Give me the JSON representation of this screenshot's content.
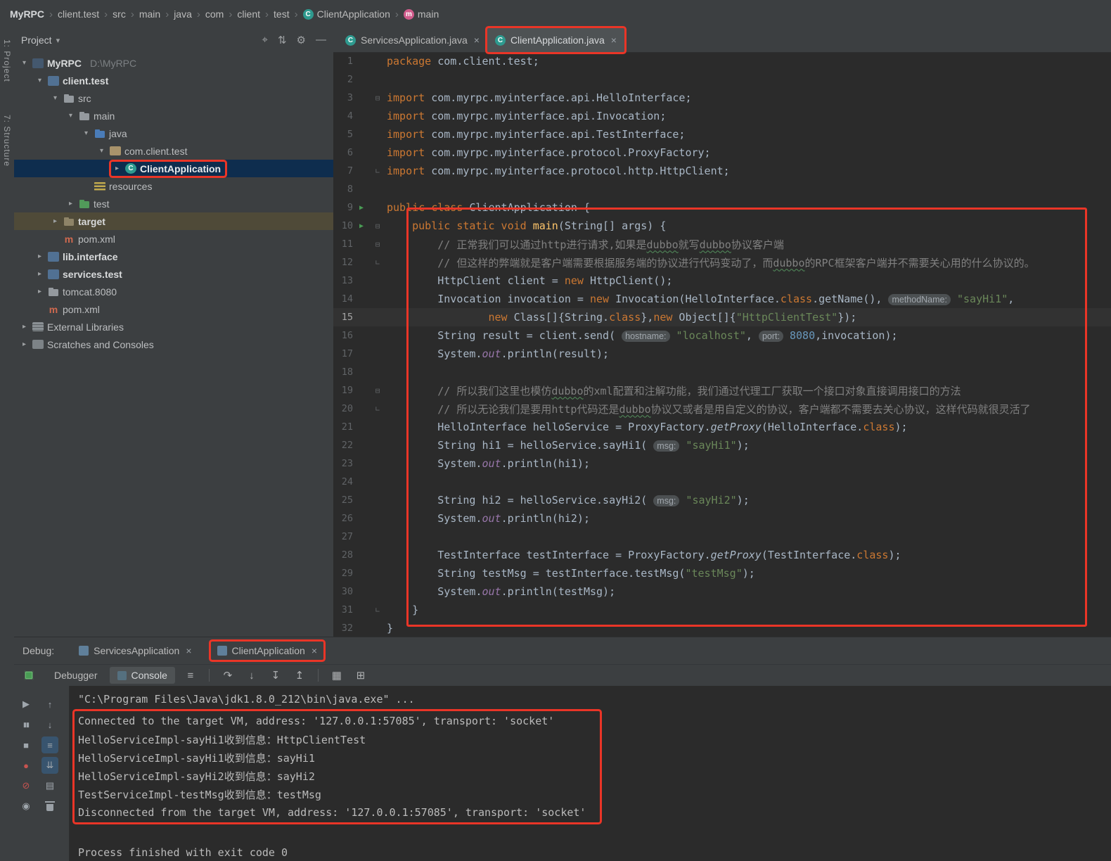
{
  "colors": {
    "annotation_red": "#ea3527",
    "keyword_orange": "#cc7832",
    "string_green": "#6a8759",
    "number_blue": "#6897bb",
    "comment_gray": "#808080",
    "selection_navy": "#0e2d4e"
  },
  "navbar": {
    "items": [
      {
        "label": "MyRPC"
      },
      {
        "label": "client.test"
      },
      {
        "label": "src"
      },
      {
        "label": "main"
      },
      {
        "label": "java"
      },
      {
        "label": "com"
      },
      {
        "label": "client"
      },
      {
        "label": "test"
      },
      {
        "label": "ClientApplication",
        "icon": "class"
      },
      {
        "label": "main",
        "icon": "method"
      }
    ]
  },
  "tool_stripe": {
    "top": "1: Project",
    "middle": "7: Structure"
  },
  "project": {
    "header": {
      "title": "Project"
    },
    "tree": [
      {
        "label": "MyRPC",
        "suffix": "D:\\MyRPC",
        "indent": 0,
        "chevron": "open",
        "icon": "project",
        "bold": true
      },
      {
        "label": "client.test",
        "indent": 1,
        "chevron": "open",
        "icon": "module",
        "bold": true
      },
      {
        "label": "src",
        "indent": 2,
        "chevron": "open",
        "icon": "folder"
      },
      {
        "label": "main",
        "indent": 3,
        "chevron": "open",
        "icon": "folder"
      },
      {
        "label": "java",
        "indent": 4,
        "chevron": "open",
        "icon": "folder-source"
      },
      {
        "label": "com.client.test",
        "indent": 5,
        "chevron": "open",
        "icon": "package"
      },
      {
        "label": "ClientApplication",
        "indent": 6,
        "chevron": "closed",
        "icon": "class",
        "selected": true,
        "boxed": true
      },
      {
        "label": "resources",
        "indent": 4,
        "chevron": "",
        "icon": "folder-resources"
      },
      {
        "label": "test",
        "indent": 3,
        "chevron": "closed",
        "icon": "folder-test"
      },
      {
        "label": "target",
        "indent": 2,
        "chevron": "closed",
        "icon": "folder-excluded",
        "highlight": "target",
        "bold": true
      },
      {
        "label": "pom.xml",
        "indent": 2,
        "chevron": "",
        "icon": "maven"
      },
      {
        "label": "lib.interface",
        "indent": 1,
        "chevron": "closed",
        "icon": "module",
        "bold": true
      },
      {
        "label": "services.test",
        "indent": 1,
        "chevron": "closed",
        "icon": "module",
        "bold": true
      },
      {
        "label": "tomcat.8080",
        "indent": 1,
        "chevron": "closed",
        "icon": "folder"
      },
      {
        "label": "pom.xml",
        "indent": 1,
        "chevron": "",
        "icon": "maven"
      },
      {
        "label": "External Libraries",
        "indent": 0,
        "chevron": "closed",
        "icon": "libraries"
      },
      {
        "label": "Scratches and Consoles",
        "indent": 0,
        "chevron": "closed",
        "icon": "scratches"
      }
    ]
  },
  "editor": {
    "tabs": [
      {
        "label": "ServicesApplication.java",
        "icon": "class",
        "close": "×",
        "active": false,
        "boxed": false
      },
      {
        "label": "ClientApplication.java",
        "icon": "class",
        "close": "×",
        "active": true,
        "boxed": true
      }
    ],
    "code": [
      {
        "n": 1,
        "g": "",
        "t": [
          [
            "k",
            "package"
          ],
          [
            "d",
            " com.client.test;"
          ]
        ]
      },
      {
        "n": 2,
        "g": "",
        "t": []
      },
      {
        "n": 3,
        "g": "fold",
        "t": [
          [
            "k",
            "import"
          ],
          [
            "d",
            " com.myrpc.myinterface.api.HelloInterface;"
          ]
        ]
      },
      {
        "n": 4,
        "g": "",
        "t": [
          [
            "k",
            "import"
          ],
          [
            "d",
            " com.myrpc.myinterface.api.Invocation;"
          ]
        ]
      },
      {
        "n": 5,
        "g": "",
        "t": [
          [
            "k",
            "import"
          ],
          [
            "d",
            " com.myrpc.myinterface.api.TestInterface;"
          ]
        ]
      },
      {
        "n": 6,
        "g": "",
        "t": [
          [
            "k",
            "import"
          ],
          [
            "d",
            " com.myrpc.myinterface.protocol.ProxyFactory;"
          ]
        ]
      },
      {
        "n": 7,
        "g": "foldend",
        "t": [
          [
            "k",
            "import"
          ],
          [
            "d",
            " com.myrpc.myinterface.protocol.http.HttpClient;"
          ]
        ]
      },
      {
        "n": 8,
        "g": "",
        "t": []
      },
      {
        "n": 9,
        "g": "play",
        "t": [
          [
            "k",
            "public class "
          ],
          [
            "d",
            "ClientApplication {"
          ]
        ]
      },
      {
        "n": 10,
        "g": "play fold",
        "t": [
          [
            "d",
            "    "
          ],
          [
            "k",
            "public static void "
          ],
          [
            "m",
            "main"
          ],
          [
            "d",
            "(String[] args) {"
          ]
        ]
      },
      {
        "n": 11,
        "g": "fold",
        "t": [
          [
            "c",
            "        // 正常我们可以通过http进行请求,如果是"
          ],
          [
            "cu",
            "dubbo"
          ],
          [
            "c",
            "就写"
          ],
          [
            "cu",
            "dubbo"
          ],
          [
            "c",
            "协议客户端"
          ]
        ]
      },
      {
        "n": 12,
        "g": "foldend",
        "t": [
          [
            "c",
            "        // 但这样的弊端就是客户端需要根据服务端的协议进行代码变动了，而"
          ],
          [
            "cu",
            "dubbo"
          ],
          [
            "c",
            "的RPC框架客户端并不需要关心用的什么协议的。"
          ]
        ]
      },
      {
        "n": 13,
        "g": "",
        "t": [
          [
            "d",
            "        HttpClient client = "
          ],
          [
            "k",
            "new"
          ],
          [
            "d",
            " HttpClient();"
          ]
        ]
      },
      {
        "n": 14,
        "g": "",
        "t": [
          [
            "d",
            "        Invocation invocation = "
          ],
          [
            "k",
            "new"
          ],
          [
            "d",
            " Invocation(HelloInterface."
          ],
          [
            "k",
            "class"
          ],
          [
            "d",
            ".getName(), "
          ],
          [
            "h",
            "methodName:"
          ],
          [
            "d",
            " "
          ],
          [
            "s",
            "\"sayHi1\""
          ],
          [
            "d",
            ","
          ]
        ]
      },
      {
        "n": 15,
        "g": "",
        "caret": true,
        "t": [
          [
            "d",
            "                "
          ],
          [
            "k",
            "new"
          ],
          [
            "d",
            " Class[]{String."
          ],
          [
            "k",
            "class"
          ],
          [
            "d",
            "},"
          ],
          [
            "k",
            "new"
          ],
          [
            "d",
            " Object[]{"
          ],
          [
            "s",
            "\"HttpClientTest\""
          ],
          [
            "d",
            "});"
          ]
        ]
      },
      {
        "n": 16,
        "g": "",
        "t": [
          [
            "d",
            "        String result = client.send( "
          ],
          [
            "h",
            "hostname:"
          ],
          [
            "d",
            " "
          ],
          [
            "s",
            "\"localhost\""
          ],
          [
            "d",
            ", "
          ],
          [
            "h",
            "port:"
          ],
          [
            "d",
            " "
          ],
          [
            "n",
            "8080"
          ],
          [
            "d",
            ",invocation);"
          ]
        ]
      },
      {
        "n": 17,
        "g": "",
        "t": [
          [
            "d",
            "        System."
          ],
          [
            "f",
            "out"
          ],
          [
            "d",
            ".println(result);"
          ]
        ]
      },
      {
        "n": 18,
        "g": "",
        "t": []
      },
      {
        "n": 19,
        "g": "fold",
        "t": [
          [
            "c",
            "        // 所以我们这里也模仿"
          ],
          [
            "cu",
            "dubbo"
          ],
          [
            "c",
            "的xml配置和注解功能，我们通过代理工厂获取一个接口对象直接调用接口的方法"
          ]
        ]
      },
      {
        "n": 20,
        "g": "foldend",
        "t": [
          [
            "c",
            "        // 所以无论我们是要用http代码还是"
          ],
          [
            "cu",
            "dubbo"
          ],
          [
            "c",
            "协议又或者是用自定义的协议，客户端都不需要去关心协议，这样代码就很灵活了"
          ]
        ]
      },
      {
        "n": 21,
        "g": "",
        "t": [
          [
            "d",
            "        HelloInterface helloService = ProxyFactory."
          ],
          [
            "sm",
            "getProxy"
          ],
          [
            "d",
            "(HelloInterface."
          ],
          [
            "k",
            "class"
          ],
          [
            "d",
            ");"
          ]
        ]
      },
      {
        "n": 22,
        "g": "",
        "t": [
          [
            "d",
            "        String hi1 = helloService.sayHi1( "
          ],
          [
            "h",
            "msg:"
          ],
          [
            "d",
            " "
          ],
          [
            "s",
            "\"sayHi1\""
          ],
          [
            "d",
            ");"
          ]
        ]
      },
      {
        "n": 23,
        "g": "",
        "t": [
          [
            "d",
            "        System."
          ],
          [
            "f",
            "out"
          ],
          [
            "d",
            ".println(hi1);"
          ]
        ]
      },
      {
        "n": 24,
        "g": "",
        "t": []
      },
      {
        "n": 25,
        "g": "",
        "t": [
          [
            "d",
            "        String hi2 = helloService.sayHi2( "
          ],
          [
            "h",
            "msg:"
          ],
          [
            "d",
            " "
          ],
          [
            "s",
            "\"sayHi2\""
          ],
          [
            "d",
            ");"
          ]
        ]
      },
      {
        "n": 26,
        "g": "",
        "t": [
          [
            "d",
            "        System."
          ],
          [
            "f",
            "out"
          ],
          [
            "d",
            ".println(hi2);"
          ]
        ]
      },
      {
        "n": 27,
        "g": "",
        "t": []
      },
      {
        "n": 28,
        "g": "",
        "t": [
          [
            "d",
            "        TestInterface testInterface = ProxyFactory."
          ],
          [
            "sm",
            "getProxy"
          ],
          [
            "d",
            "(TestInterface."
          ],
          [
            "k",
            "class"
          ],
          [
            "d",
            ");"
          ]
        ]
      },
      {
        "n": 29,
        "g": "",
        "t": [
          [
            "d",
            "        String testMsg = testInterface.testMsg("
          ],
          [
            "s",
            "\"testMsg\""
          ],
          [
            "d",
            ");"
          ]
        ]
      },
      {
        "n": 30,
        "g": "",
        "t": [
          [
            "d",
            "        System."
          ],
          [
            "f",
            "out"
          ],
          [
            "d",
            ".println(testMsg);"
          ]
        ]
      },
      {
        "n": 31,
        "g": "foldend",
        "t": [
          [
            "d",
            "    }"
          ]
        ]
      },
      {
        "n": 32,
        "g": "",
        "t": [
          [
            "d",
            "}"
          ]
        ]
      }
    ]
  },
  "debug": {
    "label": "Debug:",
    "session_tabs": [
      {
        "label": "ServicesApplication",
        "close": "×",
        "boxed": false
      },
      {
        "label": "ClientApplication",
        "close": "×",
        "boxed": true
      }
    ],
    "view_tabs": [
      {
        "label": "Debugger",
        "active": false,
        "icon": ""
      },
      {
        "label": "Console",
        "active": true,
        "icon": "console"
      }
    ],
    "console": {
      "lines": [
        {
          "text": "\"C:\\Program Files\\Java\\jdk1.8.0_212\\bin\\java.exe\" ...",
          "boxed": false
        },
        {
          "text": "Connected to the target VM, address: '127.0.0.1:57085', transport: 'socket'",
          "boxed": true
        },
        {
          "text": "HelloServiceImpl-sayHi1收到信息：HttpClientTest",
          "boxed": true
        },
        {
          "text": "HelloServiceImpl-sayHi1收到信息：sayHi1",
          "boxed": true
        },
        {
          "text": "HelloServiceImpl-sayHi2收到信息：sayHi2",
          "boxed": true
        },
        {
          "text": "TestServiceImpl-testMsg收到信息：testMsg",
          "boxed": true
        },
        {
          "text": "Disconnected from the target VM, address: '127.0.0.1:57085', transport: 'socket'",
          "boxed": true
        },
        {
          "text": "",
          "boxed": false
        },
        {
          "text": "Process finished with exit code 0",
          "boxed": false
        }
      ]
    }
  }
}
